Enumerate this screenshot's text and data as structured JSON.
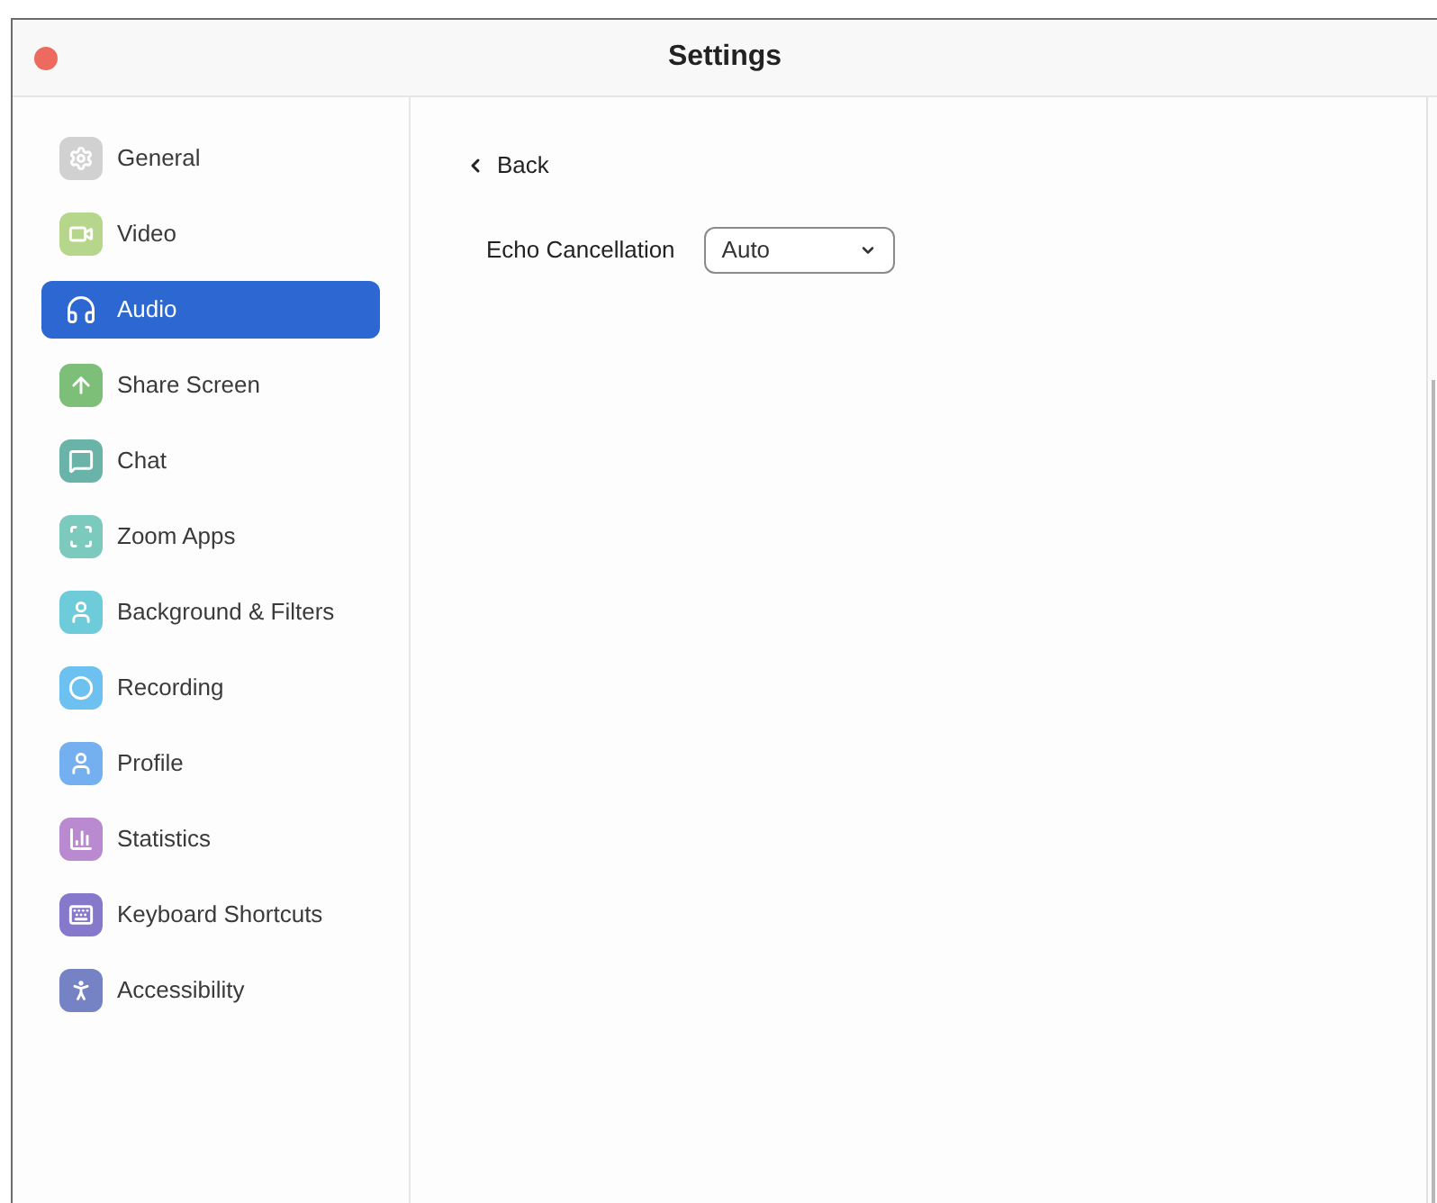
{
  "window": {
    "title": "Settings"
  },
  "sidebar": {
    "items": [
      {
        "label": "General",
        "kind": "gear",
        "color": "#d1d1d1",
        "selected": false
      },
      {
        "label": "Video",
        "kind": "camera",
        "color": "#b6d68c",
        "selected": false
      },
      {
        "label": "Audio",
        "kind": "headphones",
        "selected": true
      },
      {
        "label": "Share Screen",
        "kind": "share",
        "color": "#7dbf78",
        "selected": false
      },
      {
        "label": "Chat",
        "kind": "chat",
        "color": "#6ab3a8",
        "selected": false
      },
      {
        "label": "Zoom Apps",
        "kind": "apps",
        "color": "#7ccabd",
        "selected": false
      },
      {
        "label": "Background & Filters",
        "kind": "background",
        "color": "#6ecbd9",
        "selected": false
      },
      {
        "label": "Recording",
        "kind": "record",
        "color": "#6cc1f0",
        "selected": false
      },
      {
        "label": "Profile",
        "kind": "person",
        "color": "#74aff0",
        "selected": false
      },
      {
        "label": "Statistics",
        "kind": "stats",
        "color": "#b98ad0",
        "selected": false
      },
      {
        "label": "Keyboard Shortcuts",
        "kind": "keyboard",
        "color": "#8679cc",
        "selected": false
      },
      {
        "label": "Accessibility",
        "kind": "accessibility",
        "color": "#7583c4",
        "selected": false
      }
    ]
  },
  "content": {
    "back": "Back",
    "echo_cancellation": {
      "label": "Echo Cancellation",
      "value": "Auto"
    }
  }
}
